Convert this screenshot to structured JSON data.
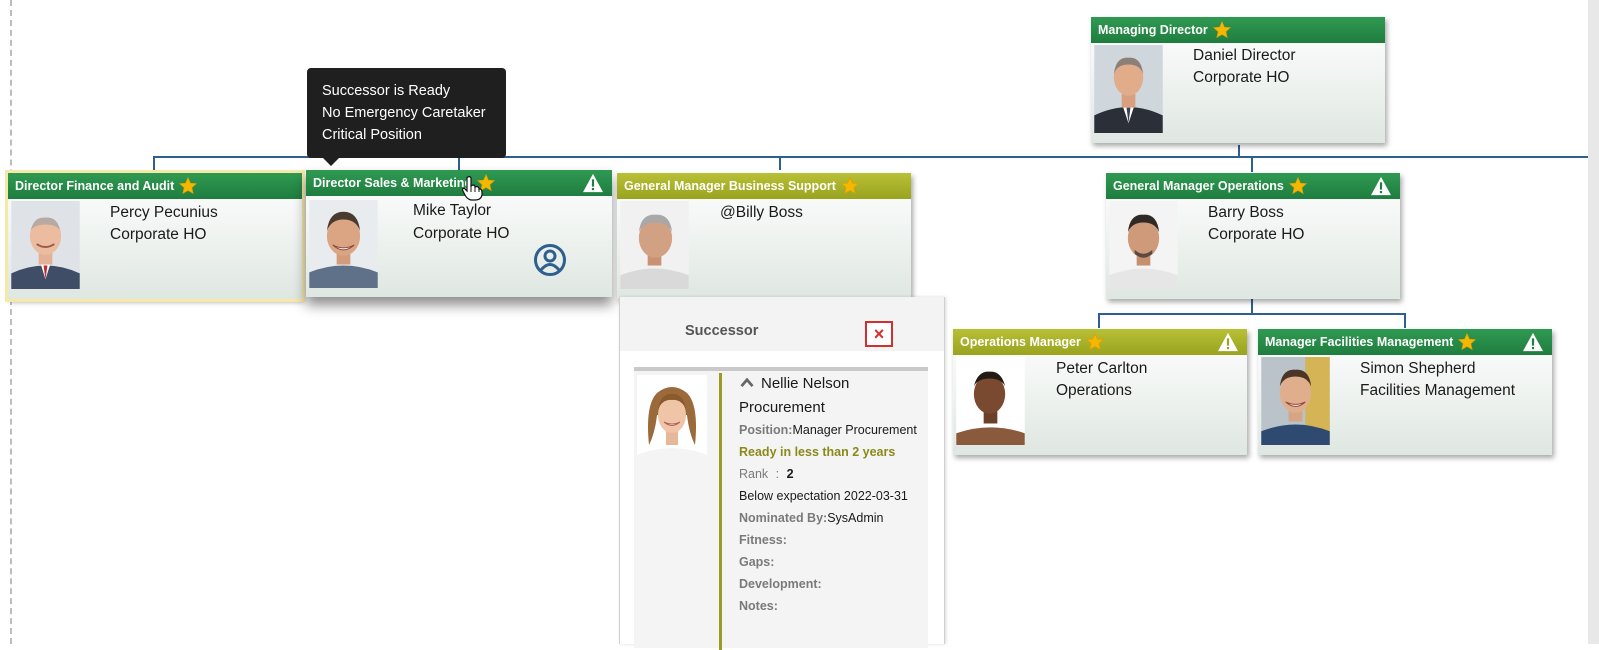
{
  "tooltip": {
    "lines": [
      "Successor is Ready",
      "No Emergency Caretaker",
      "Critical Position"
    ]
  },
  "nodes": {
    "managing_director": {
      "title": "Managing Director",
      "name": "Daniel Director",
      "location": "Corporate HO"
    },
    "finance": {
      "title": "Director Finance and Audit",
      "name": "Percy Pecunius",
      "location": "Corporate HO"
    },
    "sales": {
      "title": "Director Sales & Marketing",
      "name": "Mike Taylor",
      "location": "Corporate HO"
    },
    "business_support": {
      "title": "General Manager Business Support",
      "name": "@Billy Boss"
    },
    "operations_gm": {
      "title": "General Manager Operations",
      "name": "Barry Boss",
      "location": "Corporate HO"
    },
    "operations_manager": {
      "title": "Operations Manager",
      "name": "Peter Carlton",
      "location": "Operations"
    },
    "facilities": {
      "title": "Manager Facilities Management",
      "name": "Simon Shepherd",
      "location": "Facilities Management"
    }
  },
  "successor_panel": {
    "title": "Successor",
    "close_label": "×",
    "successor": {
      "name": "Nellie Nelson",
      "department": "Procurement",
      "position_label": "Position:",
      "position": "Manager Procurement",
      "readiness": "Ready in less than 2 years",
      "rank_label": "Rank",
      "rank_sep": ":",
      "rank": "2",
      "performance": "Below expectation 2022-03-31",
      "nominated_label": "Nominated By:",
      "nominated_by": "SysAdmin",
      "fitness_label": "Fitness:",
      "gaps_label": "Gaps:",
      "development_label": "Development:",
      "notes_label": "Notes:"
    }
  },
  "colors": {
    "header_green": "#1f7d3f",
    "header_olive": "#99a31f",
    "connector": "#2d5f8f",
    "star": "#f5b800",
    "close_red": "#d32f2f",
    "readiness_olive": "#8a8a18"
  },
  "icons": [
    "star-icon",
    "warning-icon",
    "user-circle-icon",
    "close-icon",
    "chevron-up-icon",
    "hand-cursor-icon"
  ]
}
